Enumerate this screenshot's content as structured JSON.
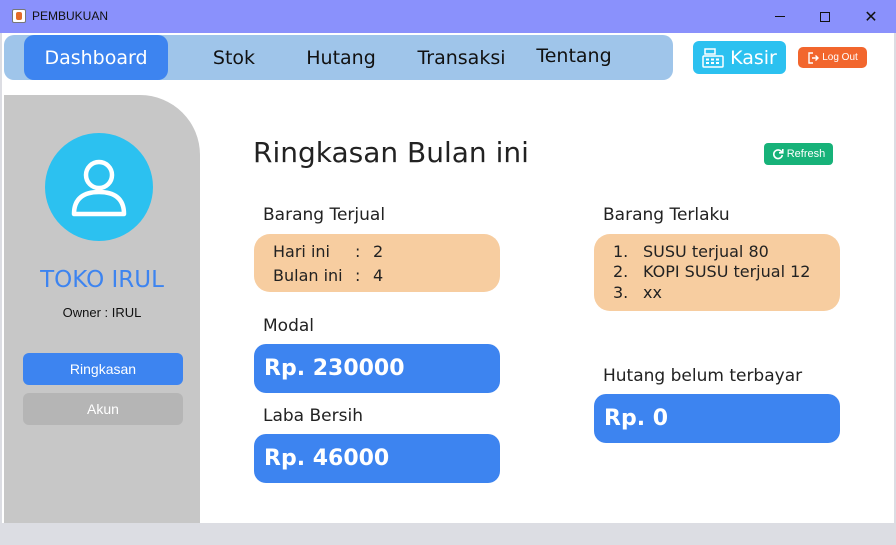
{
  "window": {
    "title": "PEMBUKUAN"
  },
  "navbar": {
    "items": [
      {
        "label": "Dashboard"
      },
      {
        "label": "Stok"
      },
      {
        "label": "Hutang"
      },
      {
        "label": "Transaksi"
      },
      {
        "label": "Tentang"
      }
    ],
    "active": "Dashboard"
  },
  "kasir_label": "Kasir",
  "logout_label": "Log Out",
  "sidebar": {
    "store_name": "TOKO IRUL",
    "owner": "Owner : IRUL",
    "buttons": [
      {
        "label": "Ringkasan"
      },
      {
        "label": "Akun"
      }
    ]
  },
  "summary": {
    "title": "Ringkasan Bulan ini",
    "refresh_label": "Refresh",
    "barang_terjual": {
      "label": "Barang Terjual",
      "rows": [
        {
          "key": "Hari ini",
          "sep": ":",
          "value": "2"
        },
        {
          "key": "Bulan ini",
          "sep": ":",
          "value": "4"
        }
      ]
    },
    "barang_terlaku": {
      "label": "Barang Terlaku",
      "items": [
        {
          "num": "1.",
          "text": "SUSU terjual 80"
        },
        {
          "num": "2.",
          "text": "KOPI SUSU terjual 12"
        },
        {
          "num": "3.",
          "text": "xx"
        }
      ]
    },
    "modal": {
      "label": "Modal",
      "value": "Rp. 230000"
    },
    "laba_bersih": {
      "label": "Laba Bersih",
      "value": "Rp. 46000"
    },
    "hutang": {
      "label": "Hutang belum terbayar",
      "value": "Rp. 0"
    }
  },
  "colors": {
    "accent": "#3d84f0",
    "titlebar": "#8a91fc",
    "navbar": "#9fc5ea",
    "kasir": "#2cc1f0",
    "logout": "#f2662d",
    "refresh": "#17b279",
    "peach": "#f7cda0"
  },
  "icons": [
    "app-icon",
    "minimize-icon",
    "maximize-icon",
    "close-icon",
    "cash-register-icon",
    "logout-icon",
    "user-icon",
    "refresh-icon"
  ]
}
